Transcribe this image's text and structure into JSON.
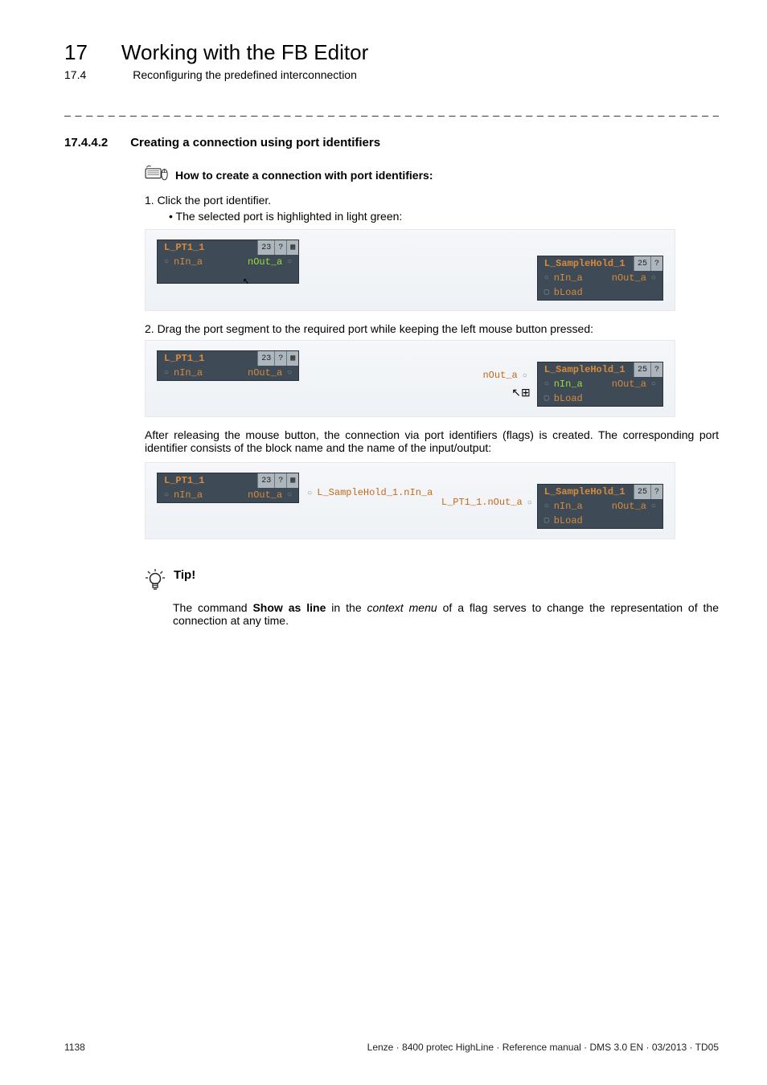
{
  "header": {
    "chapter_num": "17",
    "chapter_title": "Working with the FB Editor",
    "sub_num": "17.4",
    "sub_title": "Reconfiguring the predefined interconnection",
    "separator": "_ _ _ _ _ _ _ _ _ _ _ _ _ _ _ _ _ _ _ _ _ _ _ _ _ _ _ _ _ _ _ _ _ _ _ _ _ _ _ _ _ _ _ _ _ _ _ _ _ _ _ _ _ _ _ _ _ _ _ _ _ _ _ _"
  },
  "section": {
    "num": "17.4.4.2",
    "title": "Creating a connection using port identifiers"
  },
  "howto": {
    "label": "How to create a connection with port identifiers:"
  },
  "steps": {
    "s1": "1.   Click the port identifier.",
    "s1_bullet": "The selected port is highlighted in light green:",
    "s2": "2.   Drag the port segment to the required port while keeping the left mouse button pressed:",
    "s2_para": "After releasing the mouse button, the connection via port identifiers (flags) is created. The corresponding port identifier consists of the block name and the name of the input/output:"
  },
  "blocks": {
    "pt1_title": "L_PT1_1",
    "pt1_chip": "23",
    "pt1_in": "nIn_a",
    "pt1_out": "nOut_a",
    "sh_title": "L_SampleHold_1",
    "sh_chip": "25",
    "sh_in": "nIn_a",
    "sh_out": "nOut_a",
    "sh_bload": "bLoad",
    "flag_out": "nOut_a",
    "flag_dest_block": "L_SampleHold_1.nIn_a",
    "flag_src": "L_PT1_1.nOut_a"
  },
  "tip": {
    "title": "Tip!",
    "pre": "The command ",
    "cmd": "Show as line",
    "mid": " in the ",
    "ctx": "context menu",
    "post": " of a flag serves to change the representation of the connection at any time."
  },
  "footer": {
    "page": "1138",
    "doc": "Lenze · 8400 protec HighLine · Reference manual · DMS 3.0 EN · 03/2013 · TD05"
  }
}
